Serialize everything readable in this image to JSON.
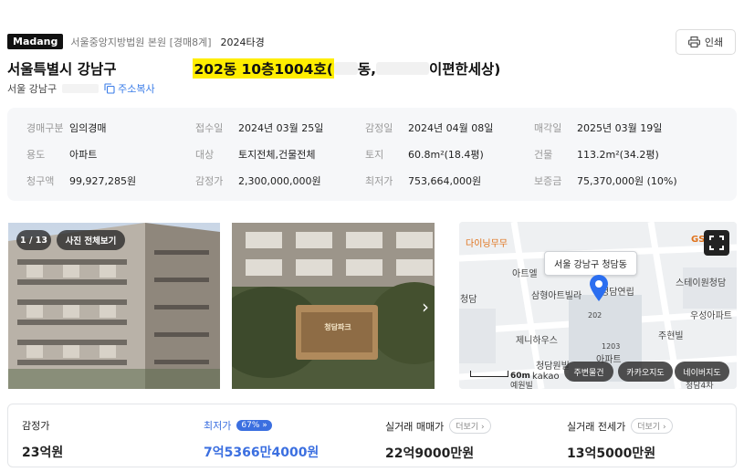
{
  "header": {
    "brand": "Madang",
    "court": "서울중앙지방법원 본원 [경매8계]",
    "case_no": "2024타경",
    "print_label": "인쇄"
  },
  "title": {
    "part1": "서울특별시 강남구",
    "highlight": "202동 10층1004호(",
    "part2": "동,",
    "part3": "이편한세상)"
  },
  "sub_address": {
    "text": "서울 강남구",
    "copy_label": "주소복사"
  },
  "info": {
    "rows": [
      [
        {
          "k": "경매구분",
          "v": "임의경매"
        },
        {
          "k": "접수일",
          "v": "2024년 03월 25일"
        },
        {
          "k": "감정일",
          "v": "2024년 04월 08일"
        },
        {
          "k": "매각일",
          "v": "2025년 03월 19일"
        }
      ],
      [
        {
          "k": "용도",
          "v": "아파트"
        },
        {
          "k": "대상",
          "v": "토지전체,건물전체"
        },
        {
          "k": "토지",
          "v": "60.8m²(18.4평)"
        },
        {
          "k": "건물",
          "v": "113.2m²(34.2평)"
        }
      ],
      [
        {
          "k": "청구액",
          "v": "99,927,285원"
        },
        {
          "k": "감정가",
          "v": "2,300,000,000원"
        },
        {
          "k": "최저가",
          "v": "753,664,000원"
        },
        {
          "k": "보증금",
          "v": "75,370,000원 (10%)"
        }
      ]
    ]
  },
  "gallery": {
    "counter": "1 / 13",
    "view_all": "사진 전체보기",
    "sign_text": "청담파크"
  },
  "map": {
    "tooltip": "서울 강남구 청담동",
    "labels": [
      "다이닝무무",
      "아트엘",
      "삼형아트빌라",
      "청담연립",
      "스테이원청담",
      "우성아파트",
      "주현빌",
      "제니하우스",
      "청담원빌",
      "청담",
      "202",
      "1203",
      "아파트",
      "GS",
      "청담4차",
      "예원빌"
    ],
    "scale": "60m",
    "logo": "kakao",
    "buttons": [
      "주변물건",
      "카카오지도",
      "네이버지도"
    ]
  },
  "prices": {
    "appraisal": {
      "label": "감정가",
      "value": "23억원"
    },
    "minimum": {
      "label": "최저가",
      "percent": "67%",
      "value": "7억5366만4000원"
    },
    "sale": {
      "label": "실거래 매매가",
      "more": "더보기",
      "value": "22억9000만원"
    },
    "jeonse": {
      "label": "실거래 전세가",
      "more": "더보기",
      "value": "13억5000만원"
    }
  }
}
